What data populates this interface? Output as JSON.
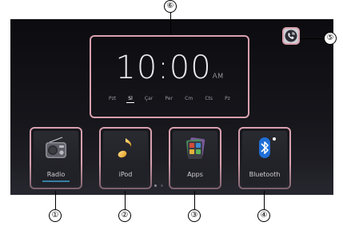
{
  "clock": {
    "time": "10:00",
    "ampm": "AM",
    "days": [
      {
        "label": "Pzt",
        "active": false
      },
      {
        "label": "Sl",
        "active": true
      },
      {
        "label": "Çar",
        "active": false
      },
      {
        "label": "Per",
        "active": false
      },
      {
        "label": "Cm",
        "active": false
      },
      {
        "label": "Cts",
        "active": false
      },
      {
        "label": "Pz",
        "active": false
      }
    ]
  },
  "phone": {
    "icon": "phone-icon"
  },
  "tiles": [
    {
      "label": "Radio",
      "icon": "radio-icon",
      "selected": true
    },
    {
      "label": "iPod",
      "icon": "music-note-icon",
      "selected": false
    },
    {
      "label": "Apps",
      "icon": "apps-icon",
      "selected": false
    },
    {
      "label": "Bluetooth",
      "icon": "bluetooth-icon",
      "selected": false
    }
  ],
  "page_indicator": {
    "current": 1,
    "total": 2
  },
  "callouts": {
    "c1": "①",
    "c2": "②",
    "c3": "③",
    "c4": "④",
    "c5": "⑤",
    "c6": "⑥"
  },
  "colors": {
    "highlight": "#d8a0ae",
    "selected_accent": "#3fb4e4",
    "screen_background": "#15151a"
  }
}
